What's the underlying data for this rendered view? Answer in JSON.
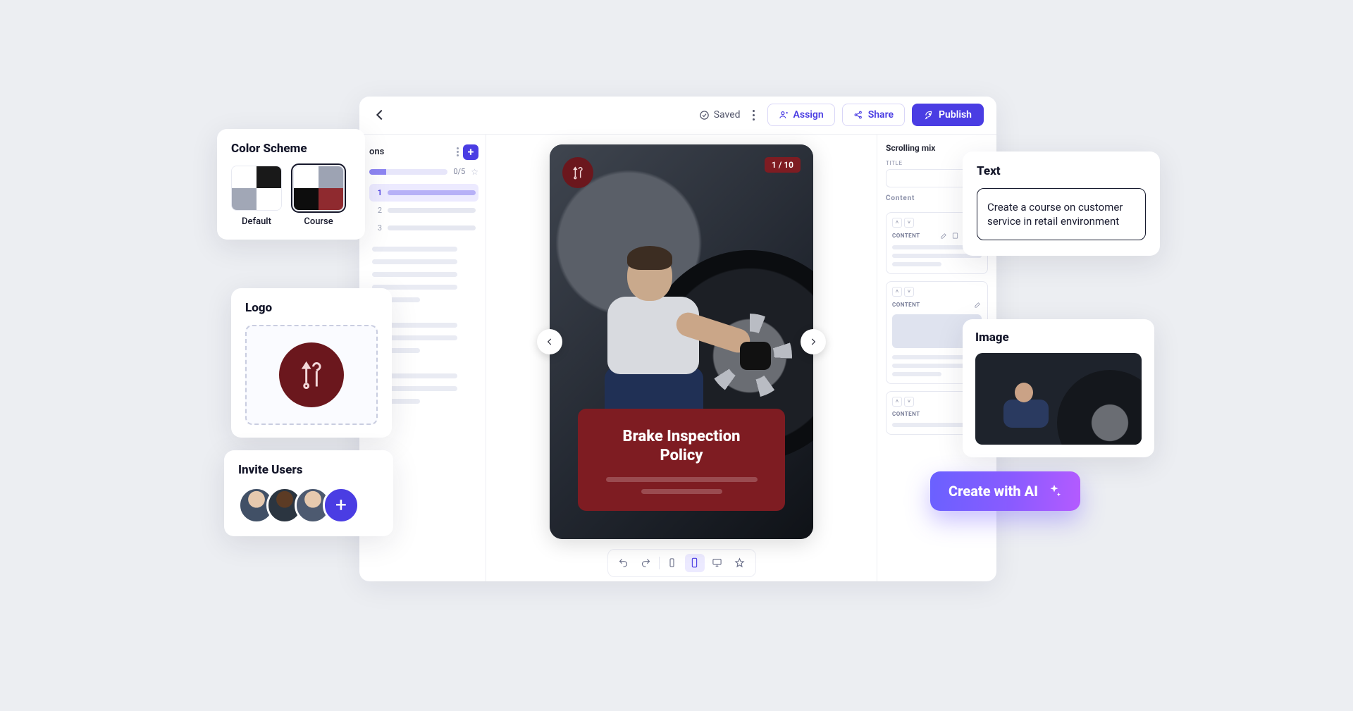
{
  "topbar": {
    "saved_label": "Saved",
    "assign_label": "Assign",
    "share_label": "Share",
    "publish_label": "Publish"
  },
  "outline": {
    "header": "ons",
    "progress_pct": "0/5",
    "items": [
      {
        "num": "1"
      },
      {
        "num": "2"
      },
      {
        "num": "3"
      }
    ]
  },
  "slide": {
    "page_badge": "1 / 10",
    "title_line1": "Brake Inspection",
    "title_line2": "Policy"
  },
  "inspector": {
    "scrolling_label": "Scrolling mix",
    "title_label": "TITLE",
    "content_label": "Content",
    "section_tag": "CONTENT"
  },
  "cards": {
    "colors": {
      "heading": "Color Scheme",
      "default_label": "Default",
      "course_label": "Course",
      "default_swatch": [
        "#ffffff",
        "#0d0d0d",
        "#9da3b3",
        "#ffffff"
      ],
      "course_swatch": [
        "#ffffff",
        "#9da3b3",
        "#0d0d0d",
        "#8f2a2f"
      ]
    },
    "logo": {
      "heading": "Logo"
    },
    "invite": {
      "heading": "Invite Users"
    },
    "text": {
      "heading": "Text",
      "prompt": "Create a course on customer service in retail environment"
    },
    "image": {
      "heading": "Image"
    },
    "ai_button": "Create with AI"
  }
}
